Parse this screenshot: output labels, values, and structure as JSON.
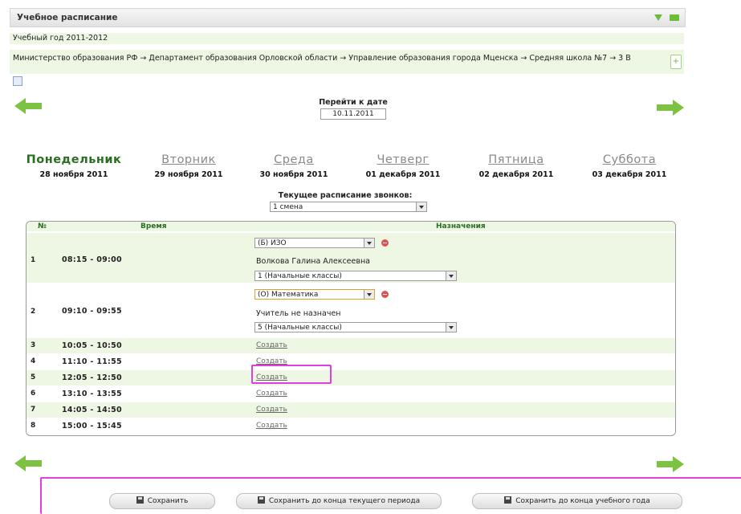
{
  "window": {
    "title": "Учебное расписание"
  },
  "year": "Учебный год 2011-2012",
  "path": "Министерство образования РФ → Департамент образования Орловской области → Управление образования города Мценска → Средняя школа №7 → 3 В",
  "goto": {
    "label": "Перейти к дате",
    "value": "10.11.2011"
  },
  "days": [
    {
      "name": "Понедельник",
      "date": "28 ноября 2011"
    },
    {
      "name": "Вторник",
      "date": "29 ноября 2011"
    },
    {
      "name": "Среда",
      "date": "30 ноября 2011"
    },
    {
      "name": "Четверг",
      "date": "01 декабря 2011"
    },
    {
      "name": "Пятница",
      "date": "02 декабря 2011"
    },
    {
      "name": "Суббота",
      "date": "03 декабря 2011"
    }
  ],
  "active_day": "Понедельник",
  "bells": {
    "label": "Текущее расписание звонков:",
    "value": "1 смена"
  },
  "table": {
    "headers": {
      "num": "№",
      "time": "Время",
      "assign": "Назначения"
    },
    "rows": [
      {
        "n": "1",
        "time": "08:15 - 09:00",
        "subject": "(Б) ИЗО",
        "teacher": "Волкова Галина Алексеевна",
        "class": "1 (Начальные классы)"
      },
      {
        "n": "2",
        "time": "09:10 - 09:55",
        "subject": "(О) Математика",
        "teacher": "Учитель не назначен",
        "class": "5 (Начальные классы)"
      },
      {
        "n": "3",
        "time": "10:05 - 10:50",
        "create": "Создать"
      },
      {
        "n": "4",
        "time": "11:10 - 11:55",
        "create": "Создать"
      },
      {
        "n": "5",
        "time": "12:05 - 12:50",
        "create": "Создать"
      },
      {
        "n": "6",
        "time": "13:10 - 13:55",
        "create": "Создать"
      },
      {
        "n": "7",
        "time": "14:05 - 14:50",
        "create": "Создать"
      },
      {
        "n": "8",
        "time": "15:00 - 15:45",
        "create": "Создать"
      }
    ]
  },
  "buttons": {
    "save": "Сохранить",
    "save_period": "Сохранить до конца текущего периода",
    "save_year": "Сохранить до конца  учебного года"
  },
  "colors": {
    "accent": "#7dc242",
    "highlight": "#e23de0",
    "row_alt": "#eef6e4"
  }
}
